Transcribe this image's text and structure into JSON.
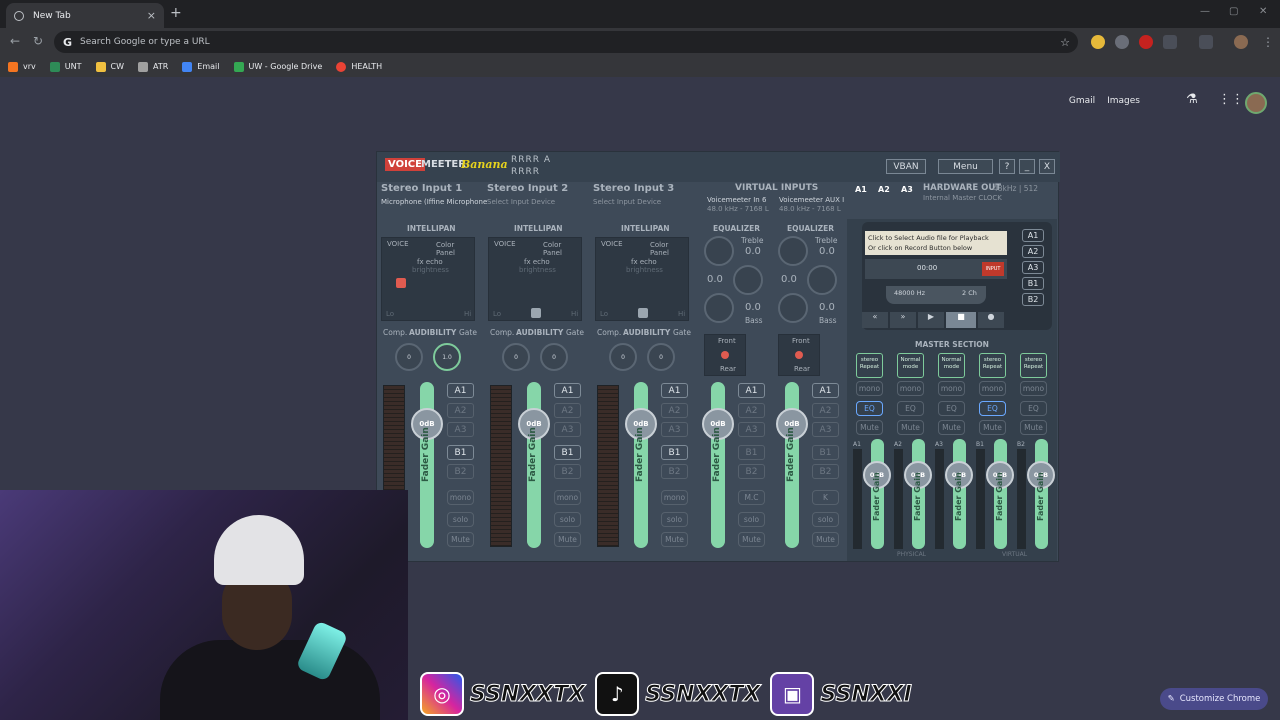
{
  "browser": {
    "tab_title": "New Tab",
    "tab_close": "×",
    "new_tab": "+",
    "omnibox_placeholder": "Search Google or type a URL",
    "bookmarks": [
      {
        "label": "vrv",
        "color": "#f47521"
      },
      {
        "label": "UNT",
        "color": "#2e8b57"
      },
      {
        "label": "CW",
        "color": "#f0c040"
      },
      {
        "label": "ATR",
        "color": "#a0a0a0"
      },
      {
        "label": "Email",
        "color": "#4285f4"
      },
      {
        "label": "UW - Google Drive",
        "color": "#34a853"
      },
      {
        "label": "HEALTH",
        "color": "#ea4335"
      }
    ],
    "ntp_links": [
      "Gmail",
      "Images"
    ],
    "customize": "Customize Chrome"
  },
  "voicemeeter": {
    "logo_voice": "VOICE",
    "logo_meter": "MEETER",
    "logo_banana": "Banana",
    "rrr": "RRRR A\nRRRR",
    "vban": "VBAN",
    "menu": "Menu",
    "help": "?",
    "minimize": "_",
    "close": "X",
    "inputs": [
      {
        "title": "Stereo Input 1",
        "device": "Microphone (Iffine Microphone"
      },
      {
        "title": "Stereo Input 2",
        "device": "Select Input Device"
      },
      {
        "title": "Stereo Input 3",
        "device": "Select Input Device"
      }
    ],
    "virtual_inputs": {
      "title": "VIRTUAL INPUTS",
      "channels": [
        {
          "name": "Voicemeeter In 6",
          "info": "48.0 kHz - 7168 L"
        },
        {
          "name": "Voicemeeter AUX I",
          "info": "48.0 kHz - 7168 L"
        }
      ]
    },
    "hardware_out": {
      "title": "HARDWARE OUT",
      "info": "48kHz | 512",
      "sub": "Internal Master CLOCK",
      "buses": [
        "A1",
        "A2",
        "A3"
      ]
    },
    "intellipan": "INTELLIPAN",
    "pan_labels": {
      "voice": "VOICE",
      "color": "Color Panel",
      "fx": "fx echo",
      "bright": "brightness",
      "lo": "Lo",
      "hi": "Hi"
    },
    "comp": "Comp.",
    "audibility": "AUDIBILITY",
    "gate": "Gate",
    "knob_values": [
      "0",
      "1.0",
      "0",
      "0",
      "0",
      "0"
    ],
    "equalizer": "EQUALIZER",
    "treble": "Treble",
    "bass": "Bass",
    "eq_value": "0.0",
    "front": "Front",
    "rear": "Rear",
    "fader_gain": "Fader Gain",
    "zero_db": "0dB",
    "bus_labels": [
      "A1",
      "A2",
      "A3",
      "B1",
      "B2"
    ],
    "mono": "mono",
    "solo": "solo",
    "mute": "Mute",
    "mc": "M.C",
    "k": "K",
    "recorder": {
      "msg1": "Click to Select Audio file for Playback",
      "msg2": "Or click on Record Button below",
      "time": "00:00",
      "rate": "48000 Hz",
      "ch": "2 Ch",
      "input_btn": "INPUT"
    },
    "master_title": "MASTER SECTION",
    "master_modes": [
      "stereo Repeat",
      "Normal mode",
      "Normal mode",
      "stereo Repeat",
      "stereo Repeat"
    ],
    "master_mono": "mono",
    "master_eq": "EQ",
    "master_mute": "Mute",
    "master_bus": [
      "A1",
      "A2",
      "A3",
      "B1",
      "B2"
    ],
    "physical": "PHYSICAL",
    "virtual": "VIRTUAL"
  },
  "social": {
    "names": [
      "SSNXXTX",
      "SSNXXTX",
      "SSNXXI"
    ]
  }
}
